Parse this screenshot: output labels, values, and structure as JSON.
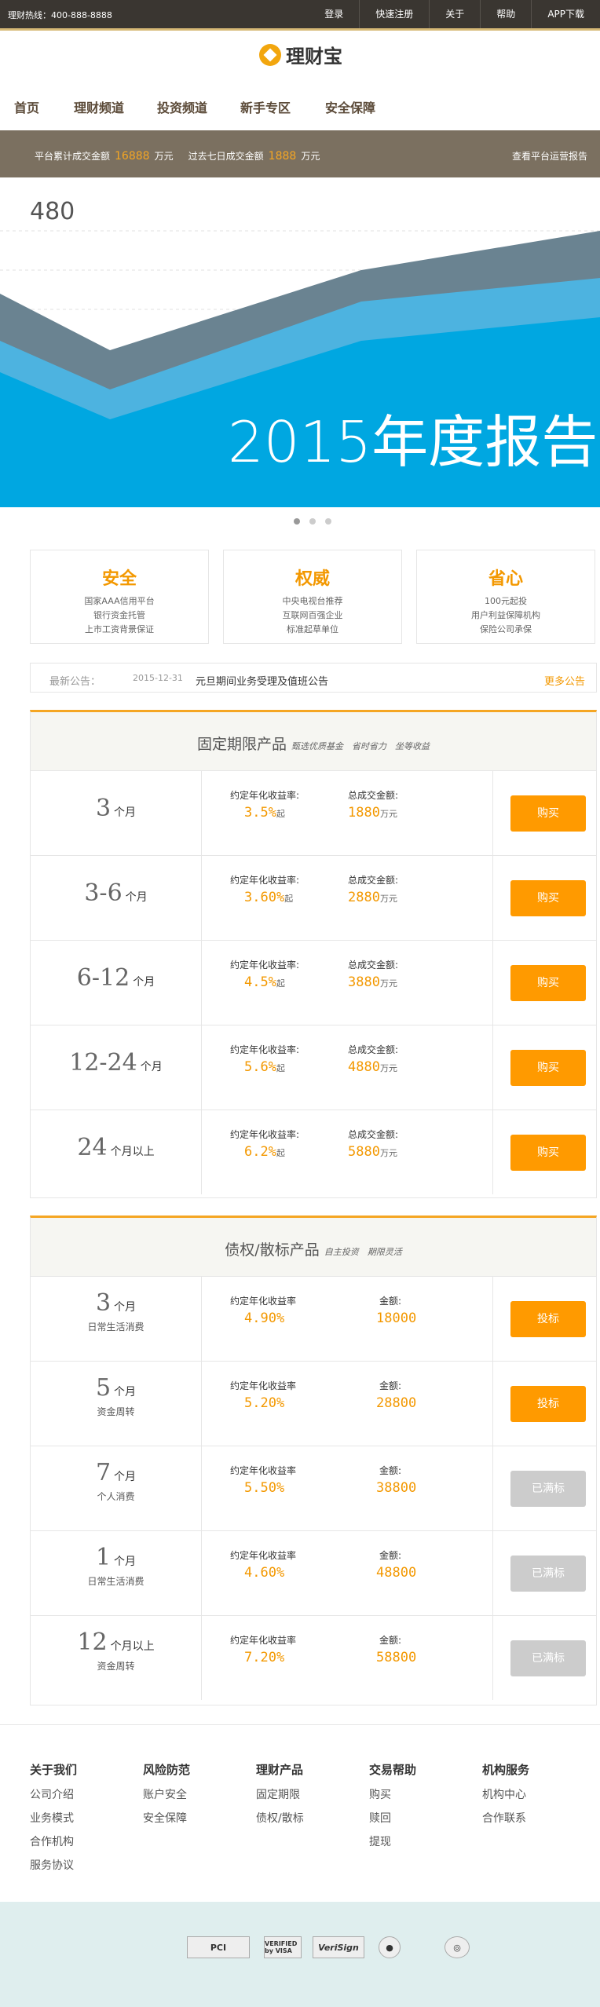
{
  "topbar": {
    "hotline": "理财热线：400-888-8888",
    "links": [
      "登录",
      "快速注册",
      "关于",
      "帮助",
      "APP下载"
    ]
  },
  "logo": {
    "name": "理财宝"
  },
  "nav": [
    "首页",
    "理财频道",
    "投资频道",
    "新手专区",
    "安全保障"
  ],
  "stats": {
    "total_label": "平台累计成交金额",
    "total_value": "16888",
    "total_unit": "万元",
    "week_label": "过去七日成交金额",
    "week_value": "1888",
    "week_unit": "万元",
    "report_link": "查看平台运营报告"
  },
  "banner": {
    "number": "480",
    "title": "2015年度报告",
    "slide_count": 3,
    "active_slide": 1
  },
  "features": [
    {
      "title": "安全",
      "lines": [
        "国家AAA信用平台",
        "银行资金托管",
        "上市工资背景保证"
      ]
    },
    {
      "title": "权威",
      "lines": [
        "中央电视台推荐",
        "互联网百强企业",
        "标准起草单位"
      ]
    },
    {
      "title": "省心",
      "lines": [
        "100元起投",
        "用户利益保障机构",
        "保险公司承保"
      ]
    }
  ],
  "notice": {
    "label": "最新公告：",
    "date": "2015-12-31",
    "text": "元旦期间业务受理及值班公告",
    "more": "更多公告"
  },
  "fixed": {
    "title": "固定期限产品",
    "slogan": "甄选优质基金　省时省力　坐等收益",
    "rate_label": "约定年化收益率:",
    "amount_label": "总成交金额:",
    "rate_suffix": "起",
    "amount_suffix": "万元",
    "button": "购买",
    "rows": [
      {
        "term": "3",
        "unit": "个月",
        "rate": "3.5%",
        "amount": "1880"
      },
      {
        "term": "3-6",
        "unit": "个月",
        "rate": "3.60%",
        "amount": "2880"
      },
      {
        "term": "6-12",
        "unit": "个月",
        "rate": "4.5%",
        "amount": "3880"
      },
      {
        "term": "12-24",
        "unit": "个月",
        "rate": "5.6%",
        "amount": "4880"
      },
      {
        "term": "24",
        "unit": "个月以上",
        "rate": "6.2%",
        "amount": "5880"
      }
    ]
  },
  "bonds": {
    "title": "债权/散标产品",
    "slogan": "自主投资　期限灵活",
    "rate_label": "约定年化收益率",
    "amount_label": "金额:",
    "rows": [
      {
        "term": "3",
        "unit": "个月",
        "purpose": "日常生活消费",
        "rate": "4.90%",
        "amount": "18000",
        "button": "投标",
        "active": true
      },
      {
        "term": "5",
        "unit": "个月",
        "purpose": "资金周转",
        "rate": "5.20%",
        "amount": "28800",
        "button": "投标",
        "active": true
      },
      {
        "term": "7",
        "unit": "个月",
        "purpose": "个人消费",
        "rate": "5.50%",
        "amount": "38800",
        "button": "已满标",
        "active": false
      },
      {
        "term": "1",
        "unit": "个月",
        "purpose": "日常生活消费",
        "rate": "4.60%",
        "amount": "48800",
        "button": "已满标",
        "active": false
      },
      {
        "term": "12",
        "unit": "个月以上",
        "purpose": "资金周转",
        "rate": "7.20%",
        "amount": "58800",
        "button": "已满标",
        "active": false
      }
    ]
  },
  "footer": [
    {
      "title": "关于我们",
      "links": [
        "公司介绍",
        "业务模式",
        "合作机构",
        "服务协议"
      ]
    },
    {
      "title": "风险防范",
      "links": [
        "账户安全",
        "安全保障"
      ]
    },
    {
      "title": "理财产品",
      "links": [
        "固定期限",
        "债权/散标"
      ]
    },
    {
      "title": "交易帮助",
      "links": [
        "购买",
        "赎回",
        "提现"
      ]
    },
    {
      "title": "机构服务",
      "links": [
        "机构中心",
        "合作联系"
      ]
    }
  ],
  "certs": [
    "PCI",
    "VERIFIED by VISA",
    "VeriSign",
    "●",
    "◎"
  ],
  "colors": {
    "accent": "#f39800",
    "button": "#ff9a00",
    "banner_blue": "#00a7e1",
    "stats_bg": "#7b7060"
  }
}
